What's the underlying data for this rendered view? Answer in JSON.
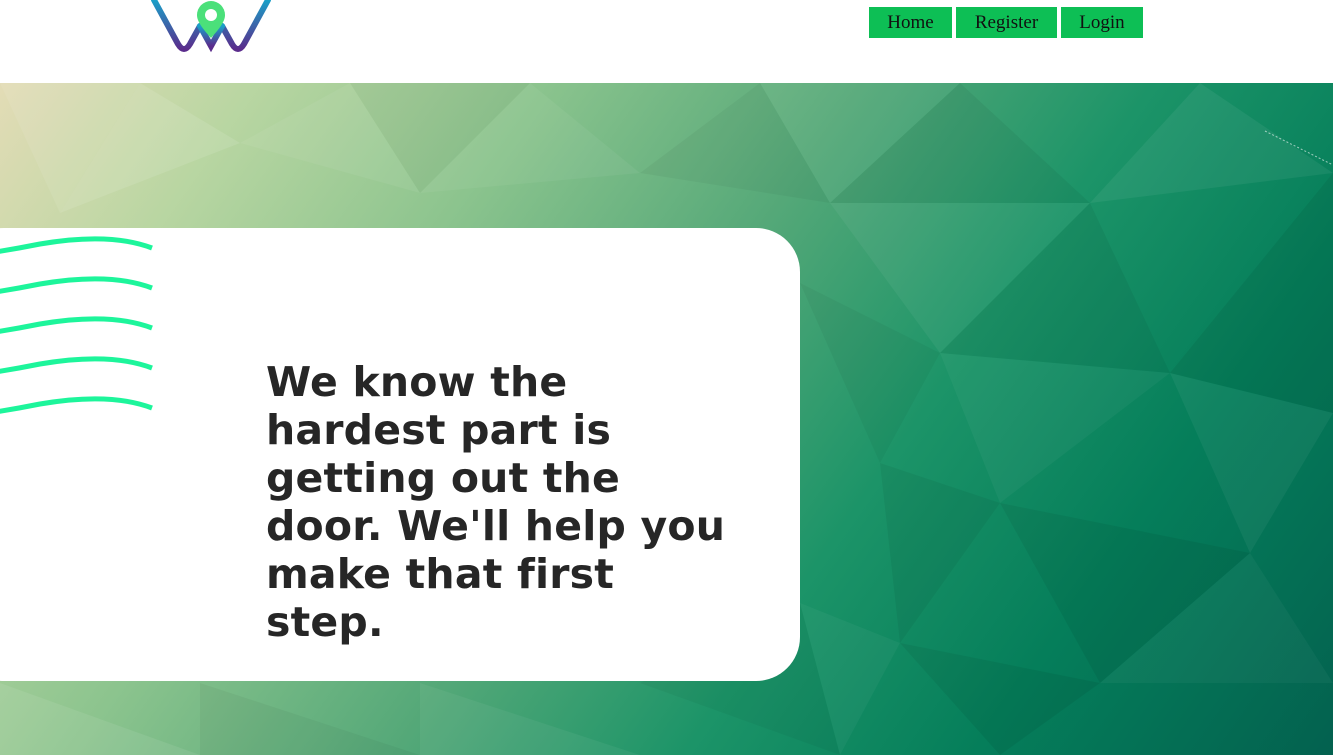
{
  "header": {
    "logo_icon": "location-pin-w-logo",
    "nav": {
      "home_label": "Home",
      "register_label": "Register",
      "login_label": "Login"
    }
  },
  "hero": {
    "tagline": "We know the hardest part is getting out the door. We'll help you make that first step.",
    "decoration_icon": "wavy-lines-icon"
  },
  "colors": {
    "nav_button": "#0dbf55",
    "wave_accent": "#1df59b",
    "logo_gradient_start": "#1aa0c8",
    "logo_gradient_end": "#5a2c8c",
    "pin": "#4be07a"
  }
}
